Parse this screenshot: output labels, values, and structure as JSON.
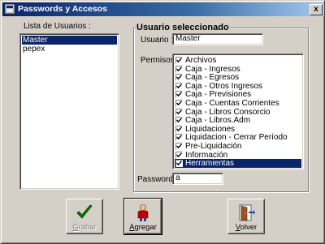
{
  "window": {
    "title": "Passwords y Accesos",
    "close_glyph": "x"
  },
  "users_panel": {
    "label": "Lista de Usuarios :",
    "items": [
      {
        "label": "Master",
        "selected": true
      },
      {
        "label": "pepex",
        "selected": false
      }
    ]
  },
  "selected_user": {
    "group_title": "Usuario seleccionado",
    "usuario_label": "Usuario :",
    "usuario_value": "Master",
    "permisos_label": "Permisos :",
    "password_label": "Password :",
    "password_value": "a"
  },
  "permissions": [
    {
      "label": "Archivos",
      "checked": true,
      "selected": false
    },
    {
      "label": "Caja - Ingresos",
      "checked": true,
      "selected": false
    },
    {
      "label": "Caja - Egresos",
      "checked": true,
      "selected": false
    },
    {
      "label": "Caja - Otros Ingresos",
      "checked": true,
      "selected": false
    },
    {
      "label": "Caja - Previsiones",
      "checked": true,
      "selected": false
    },
    {
      "label": "Caja - Cuentas Corrientes",
      "checked": true,
      "selected": false
    },
    {
      "label": "Caja - Libros Consorcio",
      "checked": true,
      "selected": false
    },
    {
      "label": "Caja - Libros.Adm",
      "checked": true,
      "selected": false
    },
    {
      "label": "Liquidaciones",
      "checked": true,
      "selected": false
    },
    {
      "label": "Liquidacion - Cerrar Período",
      "checked": true,
      "selected": false
    },
    {
      "label": "Pre-Liquidación",
      "checked": true,
      "selected": false
    },
    {
      "label": "Información",
      "checked": true,
      "selected": false
    },
    {
      "label": "Herramientas",
      "checked": true,
      "selected": true
    }
  ],
  "buttons": {
    "grabar": {
      "accel": "G",
      "rest": "rabar",
      "enabled": false,
      "icon": "checkmark-icon"
    },
    "agregar": {
      "accel": "A",
      "rest": "gregar",
      "enabled": true,
      "icon": "person-icon"
    },
    "volver": {
      "accel": "V",
      "rest": "olver",
      "enabled": true,
      "icon": "door-exit-icon"
    }
  },
  "colors": {
    "selection": "#0a246a",
    "face": "#d4d0c8",
    "check_green": "#008000"
  }
}
